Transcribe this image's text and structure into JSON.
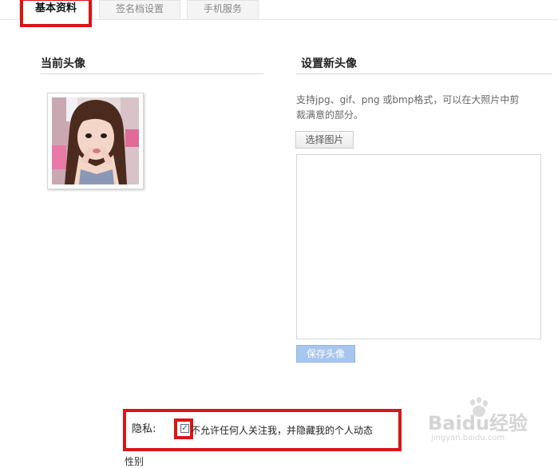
{
  "tabs": [
    {
      "label": "基本资料",
      "active": true
    },
    {
      "label": "签名档设置",
      "active": false
    },
    {
      "label": "手机服务",
      "active": false
    }
  ],
  "current_avatar": {
    "title": "当前头像"
  },
  "new_avatar": {
    "title": "设置新头像",
    "hint": "支持jpg、gif、png 或bmp格式，可以在大照片中剪裁满意的部分。",
    "choose_button": "选择图片",
    "save_button": "保存头像"
  },
  "privacy": {
    "label": "隐私:",
    "checkbox_checked": true,
    "checkbox_mark": "✓",
    "option_text": "不允许任何人关注我，并隐藏我的个人动态"
  },
  "cut_off_text": "性别",
  "watermark": {
    "logo": "Baidu经验",
    "url": "jingyan.baidu.com"
  },
  "colors": {
    "highlight_red": "#d81616",
    "save_button_blue": "#a7c6ee"
  }
}
